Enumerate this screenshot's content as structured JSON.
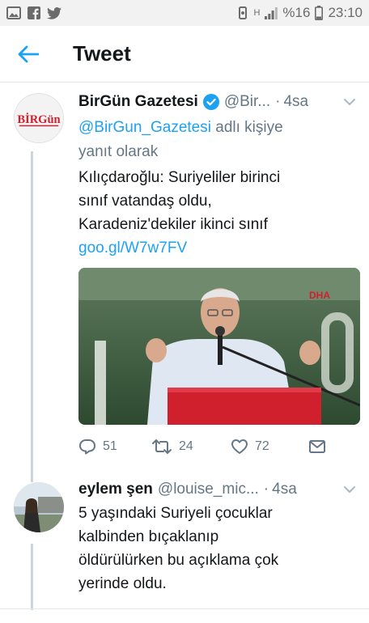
{
  "status_bar": {
    "battery_percent": "%16",
    "time": "23:10",
    "network": "H",
    "left_icons": [
      "gallery-icon",
      "facebook-icon",
      "twitter-icon"
    ]
  },
  "header": {
    "title": "Tweet",
    "back_icon": "arrow-left-icon"
  },
  "tweets": [
    {
      "name": "BirGün Gazetesi",
      "verified": true,
      "handle": "@Bir...",
      "separator": "·",
      "time": "4sa",
      "reply_to_handle": "@BirGun_Gazetesi",
      "reply_to_suffix": "adlı kişiye",
      "reply_to_line2": "yanıt olarak",
      "text_lines": [
        "Kılıçdaroğlu: Suriyeliler birinci",
        "sınıf vatandaş oldu,",
        "Karadeniz'dekiler ikinci sınıf"
      ],
      "link": "goo.gl/W7w7FV",
      "avatar_label": "BİRGün",
      "media_watermark": "DHA",
      "actions": {
        "replies": "51",
        "retweets": "24",
        "likes": "72"
      }
    },
    {
      "name": "eylem şen",
      "handle": "@louise_mic...",
      "separator": "·",
      "time": "4sa",
      "text_lines": [
        "5 yaşındaki Suriyeli çocuklar",
        "kalbinden bıçaklanıp",
        "öldürülürken bu açıklama çok",
        "yerinde oldu."
      ]
    }
  ],
  "colors": {
    "accent": "#1da1f2",
    "secondary_text": "#657786",
    "divider": "#e1e8ed",
    "birgun_red": "#d0202e"
  }
}
